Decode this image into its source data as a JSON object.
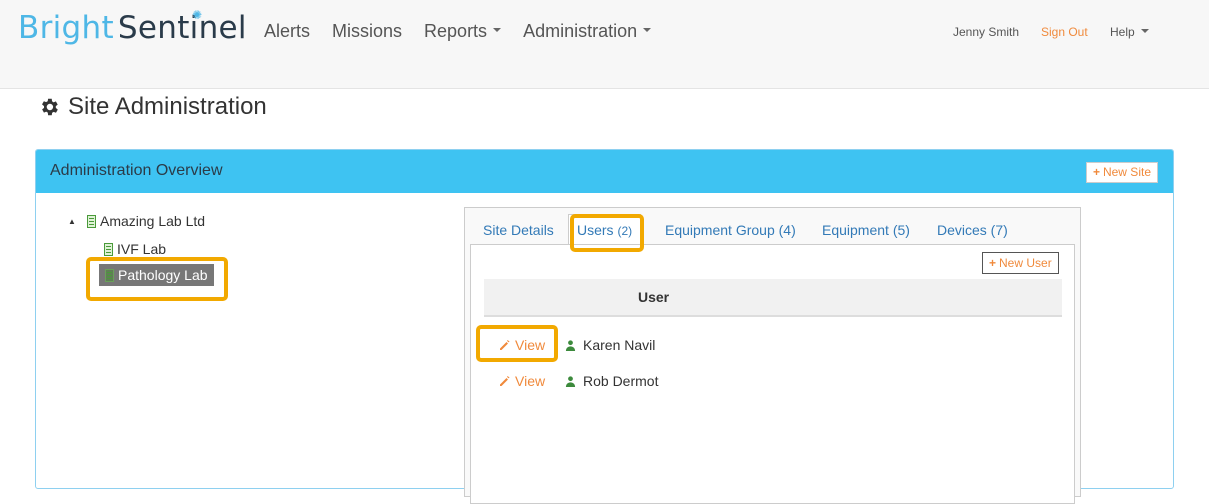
{
  "brand": {
    "part1": "Bright",
    "part2": "Sentinel"
  },
  "nav": {
    "items": [
      {
        "label": "Alerts"
      },
      {
        "label": "Missions"
      },
      {
        "label": "Reports"
      },
      {
        "label": "Administration"
      }
    ],
    "user_name": "Jenny Smith",
    "sign_out": "Sign Out",
    "help": "Help"
  },
  "page": {
    "title": "Site Administration"
  },
  "panel": {
    "title": "Administration Overview",
    "new_site_label": "New Site"
  },
  "tree": {
    "root": "Amazing Lab Ltd",
    "children": [
      "IVF Lab",
      "Pathology Lab"
    ],
    "selected": "Pathology Lab"
  },
  "tabs": [
    {
      "label": "Site Details",
      "count": ""
    },
    {
      "label": "Users",
      "count": "(2)"
    },
    {
      "label": "Equipment Group (4)",
      "count": ""
    },
    {
      "label": "Equipment (5)",
      "count": ""
    },
    {
      "label": "Devices (7)",
      "count": ""
    }
  ],
  "active_tab": "Users",
  "users_tab": {
    "new_user_label": "New User",
    "column_header": "User",
    "rows": [
      {
        "action": "View",
        "name": "Karen Navil"
      },
      {
        "action": "View",
        "name": "Rob Dermot"
      }
    ]
  },
  "colors": {
    "accent": "#3ec3f2",
    "link_orange": "#f08a3c",
    "highlight": "#f2a900",
    "link_blue": "#337ab7"
  },
  "icons": [
    "gear-icon",
    "building-icon",
    "pencil-icon",
    "user-icon",
    "plus-icon",
    "caret-down-icon",
    "tree-toggle-icon"
  ]
}
